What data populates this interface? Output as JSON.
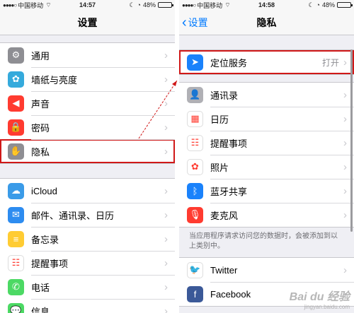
{
  "left": {
    "status": {
      "signal": "●●●●○",
      "carrier": "中国移动",
      "wifi": "⌔",
      "time": "14:57",
      "moon": "☾",
      "clock": "◔",
      "battery": "48%",
      "battery_level": 0.48
    },
    "nav": {
      "title": "设置"
    },
    "groups": [
      [
        {
          "label": "通用",
          "icon": "gear-icon",
          "glyph": "⚙",
          "color": "#8e8e93"
        },
        {
          "label": "墙纸与亮度",
          "icon": "flower-icon",
          "glyph": "✿",
          "color": "#35aadc"
        },
        {
          "label": "声音",
          "icon": "speaker-icon",
          "glyph": "◀",
          "color": "#ff3b30"
        },
        {
          "label": "密码",
          "icon": "lock-icon",
          "glyph": "🔒",
          "color": "#ff3b30"
        },
        {
          "label": "隐私",
          "icon": "hand-icon",
          "glyph": "✋",
          "color": "#8e8e93",
          "highlight": true
        }
      ],
      [
        {
          "label": "iCloud",
          "icon": "cloud-icon",
          "glyph": "☁",
          "color": "#3a9be8"
        },
        {
          "label": "邮件、通讯录、日历",
          "icon": "mail-icon",
          "glyph": "✉",
          "color": "#2d8cf0"
        },
        {
          "label": "备忘录",
          "icon": "notes-icon",
          "glyph": "≡",
          "color": "#ffcc33"
        },
        {
          "label": "提醒事项",
          "icon": "reminders-icon",
          "glyph": "☷",
          "color": "#ffffff"
        },
        {
          "label": "电话",
          "icon": "phone-icon",
          "glyph": "✆",
          "color": "#4cd964"
        },
        {
          "label": "信息",
          "icon": "messages-icon",
          "glyph": "💬",
          "color": "#4cd964"
        }
      ]
    ]
  },
  "right": {
    "status": {
      "signal": "●●●●○",
      "carrier": "中国移动",
      "wifi": "⌔",
      "time": "14:58",
      "moon": "☾",
      "clock": "◔",
      "battery": "48%",
      "battery_level": 0.48
    },
    "nav": {
      "title": "隐私",
      "back_label": "设置"
    },
    "group1": [
      {
        "label": "定位服务",
        "value": "打开",
        "icon": "location-arrow-icon",
        "glyph": "➤",
        "color": "#1a82fb",
        "highlight": true
      }
    ],
    "group2": [
      {
        "label": "通讯录",
        "icon": "contacts-icon",
        "glyph": "👤",
        "color": "#b0b0b5"
      },
      {
        "label": "日历",
        "icon": "calendar-icon",
        "glyph": "▦",
        "color": "#ffffff"
      },
      {
        "label": "提醒事项",
        "icon": "reminders-icon",
        "glyph": "☷",
        "color": "#ffffff"
      },
      {
        "label": "照片",
        "icon": "photos-icon",
        "glyph": "✿",
        "color": "#ffffff"
      },
      {
        "label": "蓝牙共享",
        "icon": "bluetooth-icon",
        "glyph": "ᛒ",
        "color": "#1a82fb"
      },
      {
        "label": "麦克风",
        "icon": "microphone-icon",
        "glyph": "🎙",
        "color": "#ff3b30"
      }
    ],
    "note": "当应用程序请求访问您的数据时，会被添加到以上类别中。",
    "group3": [
      {
        "label": "Twitter",
        "icon": "twitter-icon",
        "glyph": "🐦",
        "color": "#ffffff"
      },
      {
        "label": "Facebook",
        "icon": "facebook-icon",
        "glyph": "f",
        "color": "#3b5998"
      }
    ]
  },
  "watermark": {
    "text": "Bai du 经验",
    "sub": "jingyan.baidu.com"
  }
}
